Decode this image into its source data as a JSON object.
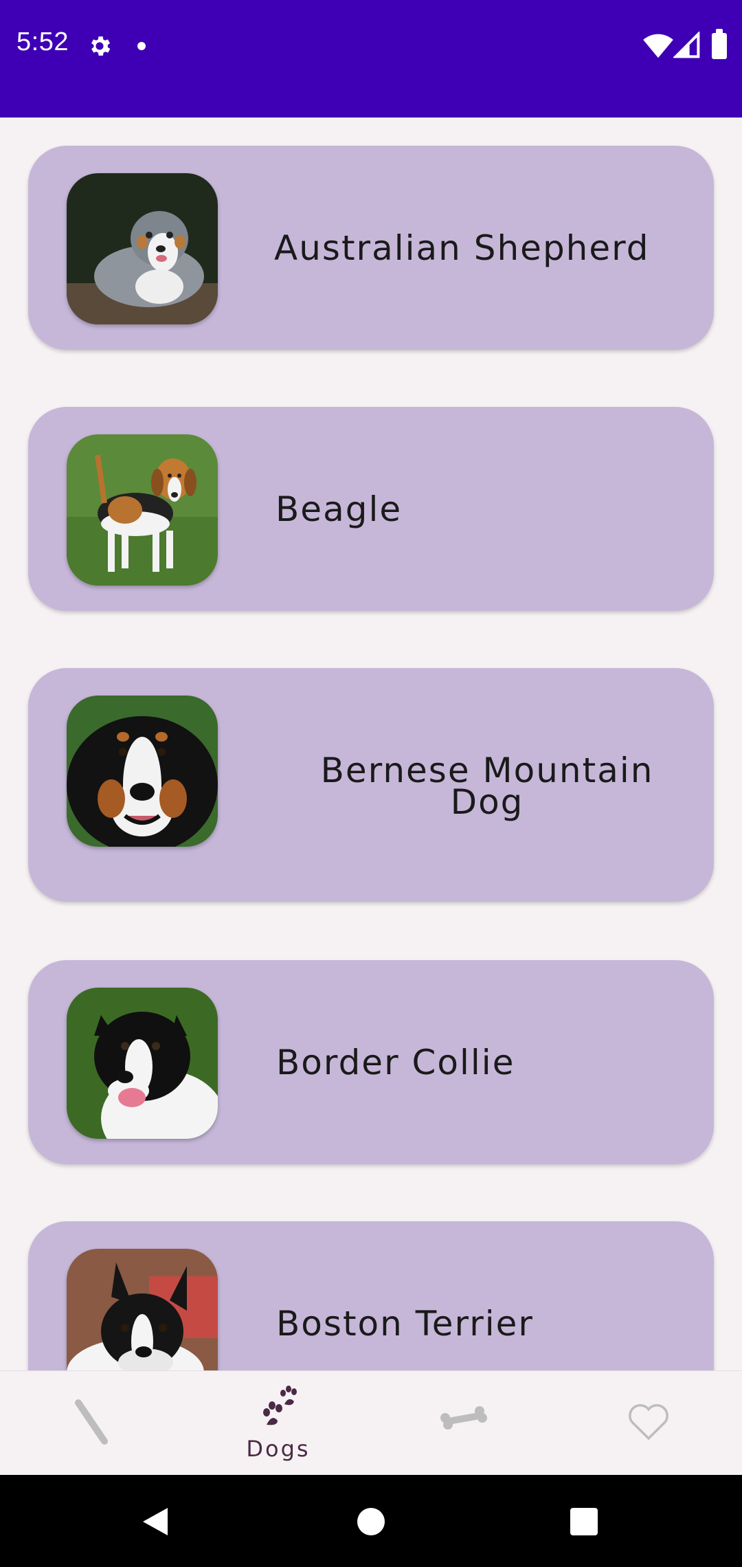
{
  "status_bar": {
    "time": "5:52",
    "icons": [
      "gear-icon",
      "notification-dot-icon",
      "wifi-icon",
      "signal-icon",
      "battery-icon"
    ],
    "background": "#3f00b5"
  },
  "dogs": [
    {
      "name": "Australian Shepherd"
    },
    {
      "name": "Beagle"
    },
    {
      "name": "Bernese Mountain Dog"
    },
    {
      "name": "Border Collie"
    },
    {
      "name": "Boston Terrier"
    }
  ],
  "card_color": "#c6b7d9",
  "bottom_nav": {
    "items": [
      {
        "icon": "pencil-icon",
        "label": ""
      },
      {
        "icon": "paw-icon",
        "label": "Dogs",
        "selected": true
      },
      {
        "icon": "bone-icon",
        "label": ""
      },
      {
        "icon": "heart-icon",
        "label": ""
      }
    ],
    "selected_color": "#4a2a45",
    "inactive_color": "#bdbdbd"
  },
  "system_nav": {
    "icons": [
      "back-icon",
      "home-icon",
      "recents-icon"
    ]
  }
}
